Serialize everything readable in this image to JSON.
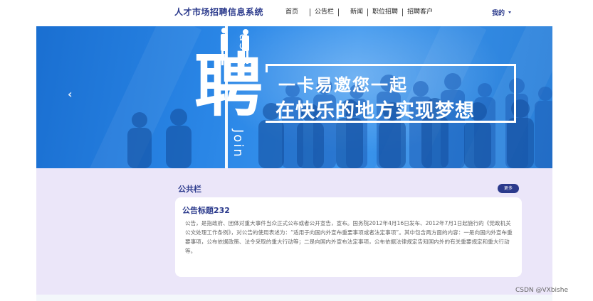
{
  "header": {
    "brand": "人才市场招聘信息系统",
    "nav": [
      "首页",
      "公告栏",
      "新闻",
      "职位招聘",
      "招聘客户"
    ],
    "user_menu": "我的"
  },
  "banner": {
    "big_char": "聘",
    "slogan_line1": "一卡易邀您一起",
    "slogan_line2": "在快乐的地方实现梦想",
    "vertical_top": "us",
    "vertical_bottom": "Join",
    "prev_arrow": "‹",
    "colors": {
      "bg": "#2a86e6",
      "text": "#ffffff"
    }
  },
  "notice": {
    "section_title": "公共栏",
    "more_label": "更多",
    "card_title": "公告标题232",
    "card_body": "公告，是指政府、团体对重大事件当众正式公布或者公开宣告，宣布。国务院2012年4月16日发布、2012年7月1日起施行的《党政机关公文处理工作条例》，对公告的使用表述为：“适用于向国内外宣布重要事项或者法定事项”。其中包含两方面的内容：一是向国内外宣布重要事项，公布依据政策、法令采取的重大行动等；二是向国内外宣布法定事项，公布依据法律规定告知国内外的有关重要规定和重大行动等。"
  },
  "watermark": "CSDN @VXbishe",
  "theme": {
    "primary": "#2b3a8c",
    "section_bg": "#ebe6f9"
  }
}
